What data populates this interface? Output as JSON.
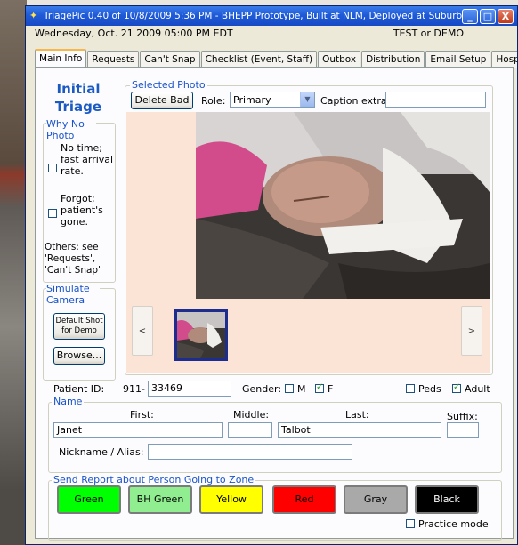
{
  "window": {
    "title": "TriagePic 0.40 of 10/8/2009 5:36 PM - BHEPP Prototype, Built at NLM, Deployed at Suburban",
    "minimize": "_",
    "maximize": "□",
    "close": "X"
  },
  "header": {
    "date": "Wednesday, Oct. 21 2009 05:00 PM EDT",
    "mode": "TEST or DEMO"
  },
  "tabs": [
    {
      "label": "Main Info",
      "active": true
    },
    {
      "label": "Requests"
    },
    {
      "label": "Can't Snap"
    },
    {
      "label": "Checklist (Event, Staff)"
    },
    {
      "label": "Outbox"
    },
    {
      "label": "Distribution"
    },
    {
      "label": "Email Setup"
    },
    {
      "label": "Hospital"
    }
  ],
  "sidebar": {
    "title_line1": "Initial",
    "title_line2": "Triage",
    "why_no_photo": {
      "legend": "Why No Photo",
      "option1": {
        "text": "No time; fast arrival rate.",
        "checked": false
      },
      "option2": {
        "text": "Forgot; patient's gone.",
        "checked": false
      },
      "others": "Others: see 'Requests', 'Can't Snap'"
    },
    "simulate_camera": {
      "legend": "Simulate Camera",
      "default_shot": "Default Shot for Demo",
      "browse": "Browse..."
    }
  },
  "selected_photo": {
    "legend": "Selected Photo",
    "delete_bad": "Delete Bad",
    "role_label": "Role:",
    "role_value": "Primary",
    "caption_label": "Caption extra:",
    "caption_value": "",
    "prev": "<",
    "next": ">"
  },
  "patient": {
    "id_label": "Patient ID:",
    "id_prefix": "911-",
    "id_value": "33469",
    "gender_label": "Gender:",
    "male_label": "M",
    "male_checked": false,
    "female_label": "F",
    "female_checked": true,
    "peds_label": "Peds",
    "peds_checked": false,
    "adult_label": "Adult",
    "adult_checked": true
  },
  "name": {
    "legend": "Name",
    "first_label": "First:",
    "first_value": "Janet",
    "middle_label": "Middle:",
    "middle_value": "",
    "last_label": "Last:",
    "last_value": "Talbot",
    "suffix_label": "Suffix:",
    "suffix_value": "",
    "nickname_label": "Nickname / Alias:",
    "nickname_value": ""
  },
  "zone": {
    "legend": "Send Report about Person Going to Zone",
    "buttons": [
      {
        "label": "Green",
        "bg": "#00ff00",
        "fg": "#000000"
      },
      {
        "label": "BH Green",
        "bg": "#90ee90",
        "fg": "#000000"
      },
      {
        "label": "Yellow",
        "bg": "#ffff00",
        "fg": "#000000"
      },
      {
        "label": "Red",
        "bg": "#ff0000",
        "fg": "#000000"
      },
      {
        "label": "Gray",
        "bg": "#a9a9a9",
        "fg": "#000000"
      },
      {
        "label": "Black",
        "bg": "#000000",
        "fg": "#ffffff"
      }
    ],
    "practice_label": "Practice mode",
    "practice_checked": false
  }
}
